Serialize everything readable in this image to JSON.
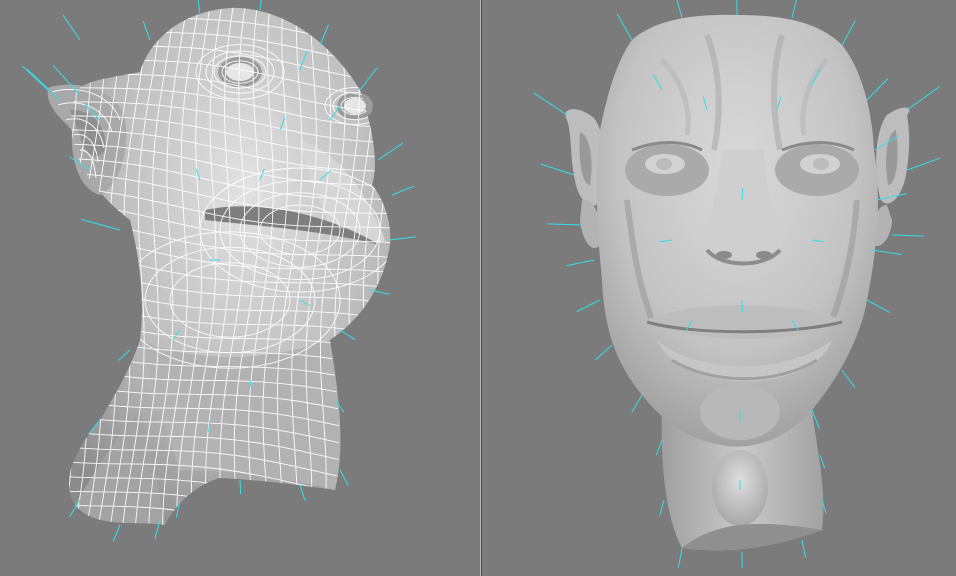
{
  "viewports": [
    {
      "id": "left",
      "display_mode": "wireframe-on-shaded",
      "model": "head-sculpt",
      "angle": "three-quarter-low",
      "normals_shown": true
    },
    {
      "id": "right",
      "display_mode": "smooth-shaded",
      "model": "head-sculpt",
      "angle": "front",
      "normals_shown": true
    }
  ],
  "colors": {
    "viewport_bg": "#7b7b7b",
    "mesh_surface": "#c8c8c8",
    "wire": "#ffffff",
    "normals": "#30e0ea",
    "divider": "#4d4d4d"
  }
}
